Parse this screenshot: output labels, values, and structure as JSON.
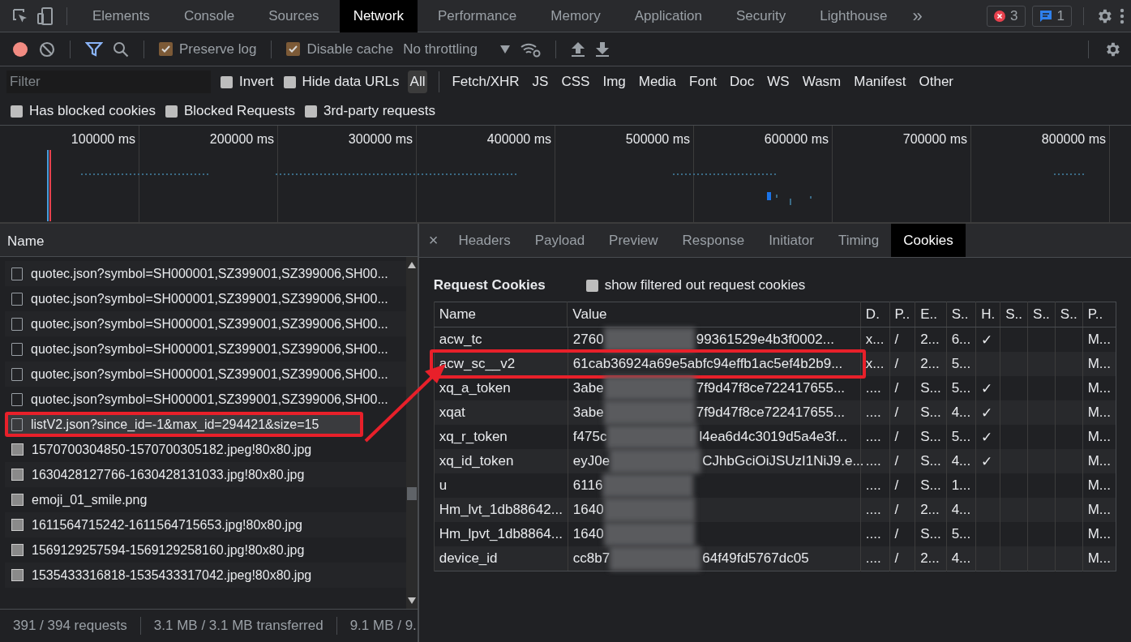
{
  "devtools_tabs": [
    {
      "label": "Elements",
      "selected": false
    },
    {
      "label": "Console",
      "selected": false
    },
    {
      "label": "Sources",
      "selected": false
    },
    {
      "label": "Network",
      "selected": true
    },
    {
      "label": "Performance",
      "selected": false
    },
    {
      "label": "Memory",
      "selected": false
    },
    {
      "label": "Application",
      "selected": false
    },
    {
      "label": "Security",
      "selected": false
    },
    {
      "label": "Lighthouse",
      "selected": false
    }
  ],
  "overflow": "»",
  "check_mark": "✓",
  "badges": {
    "errors": "3",
    "messages": "1"
  },
  "toolbar": {
    "recording": true,
    "checks": [
      {
        "label": "Preserve log",
        "checked": true
      },
      {
        "label": "Disable cache",
        "checked": true
      }
    ],
    "throttling": "No throttling"
  },
  "filter": {
    "placeholder": "Filter",
    "checks": [
      {
        "label": "Invert",
        "checked": false
      },
      {
        "label": "Hide data URLs",
        "checked": false
      }
    ],
    "types": [
      {
        "label": "All",
        "selected": true
      },
      {
        "label": "Fetch/XHR",
        "selected": false
      },
      {
        "label": "JS",
        "selected": false
      },
      {
        "label": "CSS",
        "selected": false
      },
      {
        "label": "Img",
        "selected": false
      },
      {
        "label": "Media",
        "selected": false
      },
      {
        "label": "Font",
        "selected": false
      },
      {
        "label": "Doc",
        "selected": false
      },
      {
        "label": "WS",
        "selected": false
      },
      {
        "label": "Wasm",
        "selected": false
      },
      {
        "label": "Manifest",
        "selected": false
      },
      {
        "label": "Other",
        "selected": false
      }
    ]
  },
  "options": [
    {
      "label": "Has blocked cookies",
      "checked": false
    },
    {
      "label": "Blocked Requests",
      "checked": false
    },
    {
      "label": "3rd-party requests",
      "checked": false
    }
  ],
  "timeline": {
    "ticks": [
      "100000 ms",
      "200000 ms",
      "300000 ms",
      "400000 ms",
      "500000 ms",
      "600000 ms",
      "700000 ms",
      "800000 ms"
    ]
  },
  "requests": {
    "column": "Name",
    "items": [
      {
        "name": "quotec.json?symbol=SH000001,SZ399001,SZ399006,SH00...",
        "kind": "document",
        "highlighted": false
      },
      {
        "name": "quotec.json?symbol=SH000001,SZ399001,SZ399006,SH00...",
        "kind": "document",
        "highlighted": false
      },
      {
        "name": "quotec.json?symbol=SH000001,SZ399001,SZ399006,SH00...",
        "kind": "document",
        "highlighted": false
      },
      {
        "name": "quotec.json?symbol=SH000001,SZ399001,SZ399006,SH00...",
        "kind": "document",
        "highlighted": false
      },
      {
        "name": "quotec.json?symbol=SH000001,SZ399001,SZ399006,SH00...",
        "kind": "document",
        "highlighted": false
      },
      {
        "name": "quotec.json?symbol=SH000001,SZ399001,SZ399006,SH00...",
        "kind": "document",
        "highlighted": false
      },
      {
        "name": "listV2.json?since_id=-1&max_id=294421&size=15",
        "kind": "document",
        "highlighted": true
      },
      {
        "name": "1570700304850-1570700305182.jpeg!80x80.jpg",
        "kind": "image",
        "highlighted": false
      },
      {
        "name": "1630428127766-1630428131033.jpg!80x80.jpg",
        "kind": "image",
        "highlighted": false
      },
      {
        "name": "emoji_01_smile.png",
        "kind": "image",
        "highlighted": false
      },
      {
        "name": "1611564715242-1611564715653.jpg!80x80.jpg",
        "kind": "image",
        "highlighted": false
      },
      {
        "name": "1569129257594-1569129258160.jpg!80x80.jpg",
        "kind": "image",
        "highlighted": false
      },
      {
        "name": "1535433316818-1535433317042.jpeg!80x80.jpg",
        "kind": "image",
        "highlighted": false
      }
    ]
  },
  "detail": {
    "close": "×",
    "tabs": [
      {
        "label": "Headers",
        "selected": false
      },
      {
        "label": "Payload",
        "selected": false
      },
      {
        "label": "Preview",
        "selected": false
      },
      {
        "label": "Response",
        "selected": false
      },
      {
        "label": "Initiator",
        "selected": false
      },
      {
        "label": "Timing",
        "selected": false
      },
      {
        "label": "Cookies",
        "selected": true
      }
    ],
    "section_title": "Request Cookies",
    "show_filtered": {
      "label": "show filtered out request cookies",
      "checked": false
    },
    "columns": [
      "Name",
      "Value",
      "D.",
      "P..",
      "E..",
      "S..",
      "H.",
      "S..",
      "S..",
      "S..",
      "P.."
    ],
    "rows": [
      {
        "name": "acw_tc",
        "value_parts": [
          "2760",
          "99361529e4b3f0002..."
        ],
        "redacted": true,
        "column_3": "x...",
        "column_4": "/",
        "column_5": "2...",
        "column_6": "6...",
        "checked": true,
        "column_11": "M...",
        "highlighted": false
      },
      {
        "name": "acw_sc__v2",
        "value_parts": [
          "61cab36924a69e5abfc94effb1ac5ef4b2b9..."
        ],
        "redacted": false,
        "column_3": "x...",
        "column_4": "/",
        "column_5": "2...",
        "column_6": "5...",
        "checked": false,
        "column_11": "M...",
        "highlighted": true
      },
      {
        "name": "xq_a_token",
        "value_parts": [
          "3abe",
          "7f9d47f8ce722417655..."
        ],
        "redacted": true,
        "column_3": "....",
        "column_4": "/",
        "column_5": "S...",
        "column_6": "5...",
        "checked": true,
        "column_11": "M...",
        "highlighted": false
      },
      {
        "name": "xqat",
        "value_parts": [
          "3abe",
          "7f9d47f8ce722417655..."
        ],
        "redacted": true,
        "column_3": "....",
        "column_4": "/",
        "column_5": "S...",
        "column_6": "4...",
        "checked": true,
        "column_11": "M...",
        "highlighted": false
      },
      {
        "name": "xq_r_token",
        "value_parts": [
          "f475c",
          "l4ea6d4c3019d5a4e3f..."
        ],
        "redacted": true,
        "column_3": "....",
        "column_4": "/",
        "column_5": "S...",
        "column_6": "5...",
        "checked": true,
        "column_11": "M...",
        "highlighted": false
      },
      {
        "name": "xq_id_token",
        "value_parts": [
          "eyJ0e",
          "CJhbGciOiJSUzI1NiJ9.e..."
        ],
        "redacted": true,
        "column_3": "....",
        "column_4": "/",
        "column_5": "S...",
        "column_6": "4...",
        "checked": true,
        "column_11": "M...",
        "highlighted": false
      },
      {
        "name": "u",
        "value_parts": [
          "6116"
        ],
        "redacted": true,
        "column_3": "....",
        "column_4": "/",
        "column_5": "S...",
        "column_6": "1...",
        "checked": false,
        "column_11": "M...",
        "highlighted": false
      },
      {
        "name": "Hm_lvt_1db88642...",
        "value_parts": [
          "1640"
        ],
        "redacted": true,
        "column_3": "....",
        "column_4": "/",
        "column_5": "2...",
        "column_6": "4...",
        "checked": false,
        "column_11": "M...",
        "highlighted": false
      },
      {
        "name": "Hm_lpvt_1db8864...",
        "value_parts": [
          "1640"
        ],
        "redacted": true,
        "column_3": "....",
        "column_4": "/",
        "column_5": "S...",
        "column_6": "5...",
        "checked": false,
        "column_11": "M...",
        "highlighted": false
      },
      {
        "name": "device_id",
        "value_parts": [
          "cc8b7",
          "64f49fd5767dc05"
        ],
        "redacted": true,
        "column_3": "....",
        "column_4": "/",
        "column_5": "2...",
        "column_6": "4...",
        "checked": false,
        "column_11": "M...",
        "highlighted": false
      }
    ]
  },
  "status_bar": [
    "391 / 394 requests",
    "3.1 MB / 3.1 MB transferred",
    "9.1 MB / 9."
  ]
}
